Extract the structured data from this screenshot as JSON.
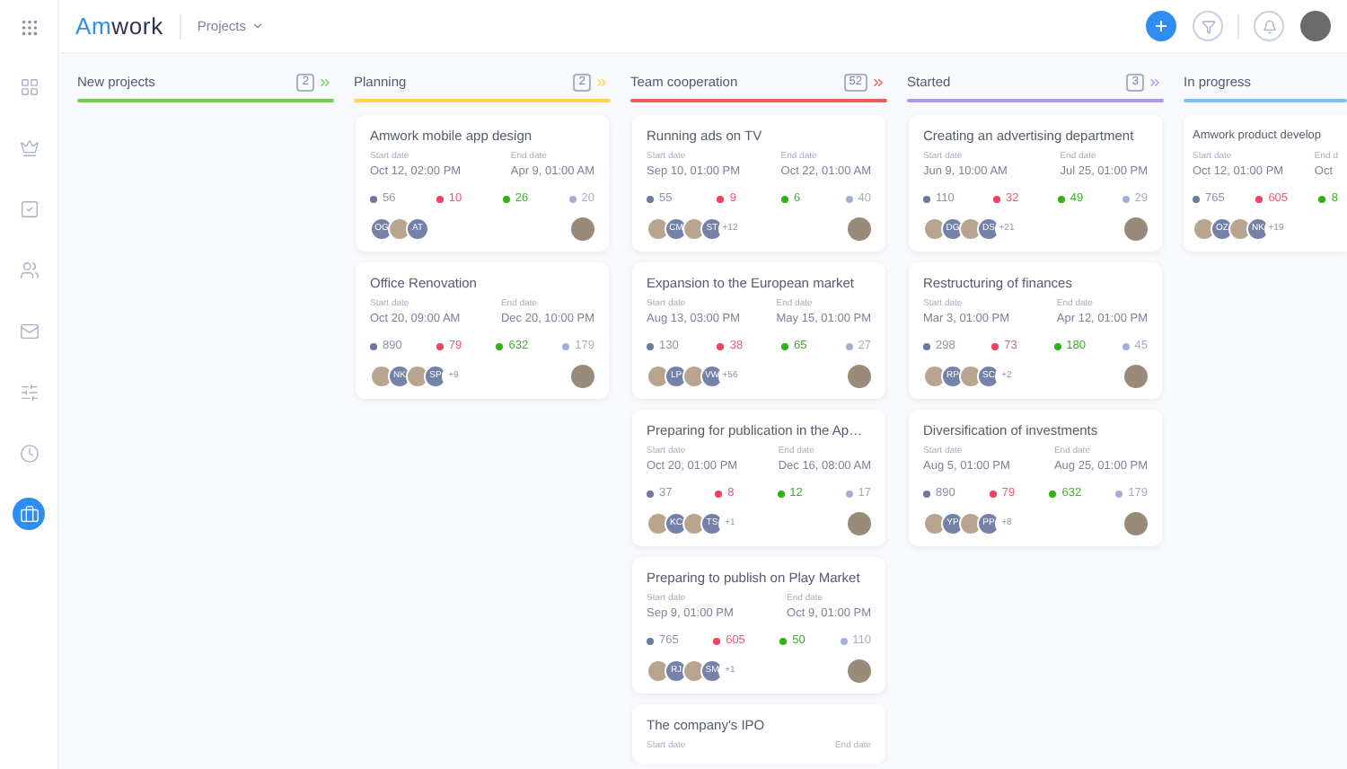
{
  "sidebar": {
    "items": [
      {
        "selected": false
      },
      {
        "selected": false
      },
      {
        "selected": false
      },
      {
        "selected": false
      },
      {
        "selected": false
      },
      {
        "selected": false
      },
      {
        "selected": false
      },
      {
        "selected": true
      }
    ]
  },
  "header": {
    "logo": [
      "Am",
      "work"
    ],
    "menu": "Projects"
  },
  "columns": [
    {
      "name": "New projects",
      "count": "2",
      "color": "#6fd04a"
    },
    {
      "name": "Planning",
      "count": "2",
      "color": "#fcd34d",
      "cards": [
        {
          "title": "Amwork mobile app design",
          "start_label": "Start date",
          "start": "Oct 12, 02:00 PM",
          "end_label": "End date",
          "end": "Apr 9, 01:00 AM",
          "stats": [
            "56",
            "10",
            "26",
            "20"
          ],
          "avatars": [
            {
              "kind": "initials",
              "text": "OG"
            },
            {
              "kind": "photo"
            },
            {
              "kind": "initials",
              "text": "AT"
            }
          ],
          "owner": true
        },
        {
          "title": "Office Renovation",
          "start_label": "Start date",
          "start": "Oct 20, 09:00 AM",
          "end_label": "End date",
          "end": "Dec 20, 10:00 PM",
          "stats": [
            "890",
            "79",
            "632",
            "179"
          ],
          "avatars": [
            {
              "kind": "photo"
            },
            {
              "kind": "initials",
              "text": "NK"
            },
            {
              "kind": "photo"
            },
            {
              "kind": "initials",
              "text": "SP"
            },
            {
              "kind": "more",
              "text": "+9"
            }
          ],
          "owner": true
        }
      ]
    },
    {
      "name": "Team cooperation",
      "count": "52",
      "color": "#f25a5a",
      "cards": [
        {
          "title": "Running ads on TV",
          "start_label": "Start date",
          "start": "Sep 10, 01:00 PM",
          "end_label": "End date",
          "end": "Oct 22, 01:00 AM",
          "stats": [
            "55",
            "9",
            "6",
            "40"
          ],
          "avatars": [
            {
              "kind": "photo"
            },
            {
              "kind": "initials",
              "text": "CM"
            },
            {
              "kind": "photo"
            },
            {
              "kind": "initials",
              "text": "ST"
            },
            {
              "kind": "more",
              "text": "+12"
            }
          ],
          "owner": true
        },
        {
          "title": "Expansion to the European market",
          "start_label": "Start date",
          "start": "Aug 13, 03:00 PM",
          "end_label": "End date",
          "end": "May 15, 01:00 PM",
          "stats": [
            "130",
            "38",
            "65",
            "27"
          ],
          "avatars": [
            {
              "kind": "photo"
            },
            {
              "kind": "initials",
              "text": "LP"
            },
            {
              "kind": "photo"
            },
            {
              "kind": "initials",
              "text": "VW"
            },
            {
              "kind": "more",
              "text": "+56"
            }
          ],
          "owner": true
        },
        {
          "title": "Preparing for publication in the Ap…",
          "start_label": "Start date",
          "start": "Oct 20, 01:00 PM",
          "end_label": "End date",
          "end": "Dec 16, 08:00 AM",
          "stats": [
            "37",
            "8",
            "12",
            "17"
          ],
          "avatars": [
            {
              "kind": "photo"
            },
            {
              "kind": "initials",
              "text": "KC"
            },
            {
              "kind": "photo"
            },
            {
              "kind": "initials",
              "text": "TS"
            },
            {
              "kind": "more",
              "text": "+1"
            }
          ],
          "owner": true
        },
        {
          "title": "Preparing to publish on Play Market",
          "start_label": "Start date",
          "start": "Sep 9, 01:00 PM",
          "end_label": "End date",
          "end": "Oct 9, 01:00 PM",
          "stats": [
            "765",
            "605",
            "50",
            "110"
          ],
          "avatars": [
            {
              "kind": "photo"
            },
            {
              "kind": "initials",
              "text": "RJ"
            },
            {
              "kind": "photo"
            },
            {
              "kind": "initials",
              "text": "SM"
            },
            {
              "kind": "more",
              "text": "+1"
            }
          ],
          "owner": true
        },
        {
          "title": "The company's IPO",
          "start_label": "Start date",
          "end_label": "End date"
        }
      ]
    },
    {
      "name": "Started",
      "count": "3",
      "color": "#b197f0",
      "cards": [
        {
          "title": "Creating an advertising department",
          "start_label": "Start date",
          "start": "Jun 9, 10:00 AM",
          "end_label": "End date",
          "end": "Jul 25, 01:00 PM",
          "stats": [
            "110",
            "32",
            "49",
            "29"
          ],
          "avatars": [
            {
              "kind": "photo"
            },
            {
              "kind": "initials",
              "text": "DG"
            },
            {
              "kind": "photo"
            },
            {
              "kind": "initials",
              "text": "DS"
            },
            {
              "kind": "more",
              "text": "+21"
            }
          ],
          "owner": true
        },
        {
          "title": "Restructuring of finances",
          "start_label": "Start date",
          "start": "Mar 3, 01:00 PM",
          "end_label": "End date",
          "end": "Apr 12, 01:00 PM",
          "stats": [
            "298",
            "73",
            "180",
            "45"
          ],
          "avatars": [
            {
              "kind": "photo"
            },
            {
              "kind": "initials",
              "text": "RP"
            },
            {
              "kind": "photo"
            },
            {
              "kind": "initials",
              "text": "SC"
            },
            {
              "kind": "more",
              "text": "+2"
            }
          ],
          "owner": true
        },
        {
          "title": "Diversification of investments",
          "start_label": "Start date",
          "start": "Aug 5, 01:00 PM",
          "end_label": "End date",
          "end": "Aug 25, 01:00 PM",
          "stats": [
            "890",
            "79",
            "632",
            "179"
          ],
          "avatars": [
            {
              "kind": "photo"
            },
            {
              "kind": "initials",
              "text": "YP"
            },
            {
              "kind": "photo"
            },
            {
              "kind": "initials",
              "text": "PP"
            },
            {
              "kind": "more",
              "text": "+8"
            }
          ],
          "owner": true
        }
      ]
    },
    {
      "name": "In progress",
      "color": "#7cc4f5",
      "cards": [
        {
          "title": "Amwork product develop",
          "start_label": "Start date",
          "start": "Oct 12, 01:00 PM",
          "end_label": "End d",
          "end": "Oct",
          "stats": [
            "765",
            "605",
            "8"
          ],
          "avatars": [
            {
              "kind": "photo"
            },
            {
              "kind": "initials",
              "text": "OZ"
            },
            {
              "kind": "photo"
            },
            {
              "kind": "initials",
              "text": "NK"
            },
            {
              "kind": "more",
              "text": "+19"
            }
          ]
        }
      ]
    }
  ]
}
